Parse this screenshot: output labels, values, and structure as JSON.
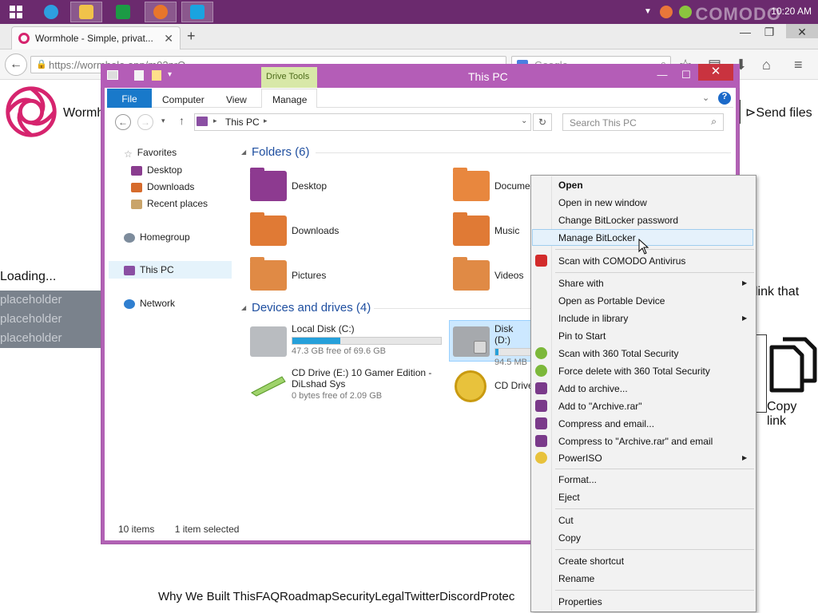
{
  "taskbar": {
    "clock": "10:20 AM",
    "watermark": "COMODO"
  },
  "browser": {
    "tab_title": "Wormhole - Simple, privat...",
    "tab_close": "✕",
    "new_tab": "+",
    "url": "https://wormhole.app/m02nrQ",
    "search_placeholder": "Google"
  },
  "page": {
    "brand_partial": "Wormh",
    "send_files": "Send files",
    "loading": "Loading...",
    "placeholders": [
      "placeholder",
      "placeholder",
      "placeholder"
    ],
    "link_that": "link that",
    "copy_link": "Copy link",
    "footer_links": [
      "Why We Built This",
      "FAQ",
      "Roadmap",
      "Security",
      "Legal",
      "Twitter",
      "Discord",
      "Protec"
    ]
  },
  "explorer": {
    "title": "This PC",
    "drive_tools": "Drive Tools",
    "ribbon_tabs": [
      "File",
      "Computer",
      "View",
      "Manage"
    ],
    "address": "This PC",
    "search_placeholder": "Search This PC",
    "nav": {
      "favorites": "Favorites",
      "desktop": "Desktop",
      "downloads": "Downloads",
      "recent": "Recent places",
      "homegroup": "Homegroup",
      "thispc": "This PC",
      "network": "Network"
    },
    "folders_header": "Folders (6)",
    "folders": [
      "Desktop",
      "Downloads",
      "Pictures",
      "Docume",
      "Music",
      "Videos"
    ],
    "devices_header": "Devices and drives (4)",
    "drives": {
      "c_name": "Local Disk (C:)",
      "c_free": "47.3 GB free of 69.6 GB",
      "c_used_fraction": 0.32,
      "d_name": "Disk (D:)",
      "d_free": "94.5 MB",
      "d_used_fraction": 0.1,
      "e_name": "CD Drive (E:) 10 Gamer Edition - DiLshad Sys",
      "e_free": "0 bytes free of 2.09 GB",
      "f_name": "CD Drive"
    },
    "status_items": "10 items",
    "status_selected": "1 item selected"
  },
  "context_menu": {
    "open": "Open",
    "open_new_window": "Open in new window",
    "change_bitlocker": "Change BitLocker password",
    "manage_bitlocker": "Manage BitLocker",
    "scan_comodo": "Scan with COMODO Antivirus",
    "share_with": "Share with",
    "open_portable": "Open as Portable Device",
    "include_library": "Include in library",
    "pin_start": "Pin to Start",
    "scan_360": "Scan with 360 Total Security",
    "force_delete_360": "Force delete with 360 Total Security",
    "add_archive": "Add to archive...",
    "add_archive_rar": "Add to \"Archive.rar\"",
    "compress_email": "Compress and email...",
    "compress_rar_email": "Compress to \"Archive.rar\" and email",
    "poweriso": "PowerISO",
    "format": "Format...",
    "eject": "Eject",
    "cut": "Cut",
    "copy": "Copy",
    "create_shortcut": "Create shortcut",
    "rename": "Rename",
    "properties": "Properties"
  },
  "colors": {
    "taskbar": "#6b2a6e",
    "explorer_frame": "#b45db7",
    "accent_blue": "#1979ca",
    "wormhole_pink": "#d6246e"
  }
}
